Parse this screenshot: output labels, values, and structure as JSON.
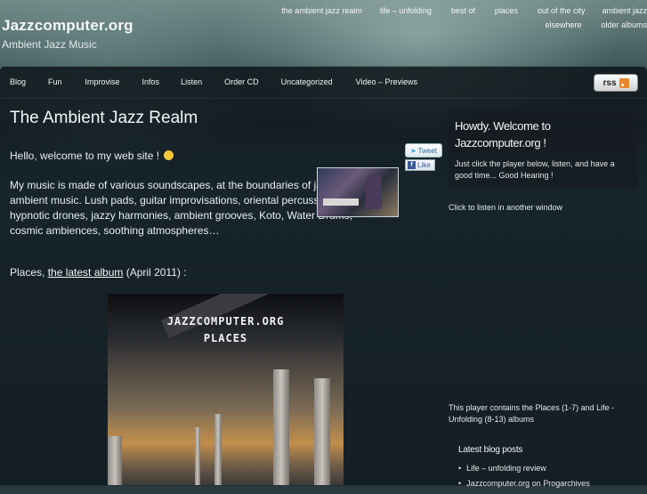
{
  "site": {
    "title": "Jazzcomputer.org",
    "tagline": "Ambient Jazz Music"
  },
  "topnav": {
    "row1": [
      "the ambient jazz realm",
      "life – unfolding",
      "best of",
      "places",
      "out of the city",
      "ambient jazz"
    ],
    "row2": [
      "elsewhere",
      "older albums"
    ]
  },
  "mainnav": [
    "Blog",
    "Fun",
    "Improvise",
    "Infos",
    "Listen",
    "Order CD",
    "Uncategorized",
    "Video – Previews"
  ],
  "rss": {
    "label": "rss"
  },
  "post": {
    "title": "The Ambient Jazz Realm",
    "greeting": "Hello, welcome to my web site !",
    "body": "My music is made of various soundscapes, at the boundaries of jazz, prog and ambient music. Lush pads, guitar improvisations, oriental percussions, hypnotic drones, jazzy harmonies, ambient grooves, Koto, Water Drums, cosmic ambiences, soothing atmospheres…",
    "places_prefix": "Places, ",
    "places_link": "the latest album",
    "places_suffix": " (April 2011) :",
    "cover_line1": "JAZZCOMPUTER.ORG",
    "cover_line2": "PLACES"
  },
  "social": {
    "tweet": "Tweet",
    "like": "Like",
    "fb": "f"
  },
  "sidebar": {
    "heading": "Howdy. Welcome to Jazzcomputer.org !",
    "intro": "Just click the player below, listen, and have a good time... Good Hearing !",
    "listen_link": "Click to listen in another window",
    "player_note": "This player contains the Places (1-7) and Life - Unfolding (8-13) albums",
    "latest_heading": "Latest blog posts",
    "latest_posts": [
      "Life – unfolding review",
      "Jazzcomputer.org on Progarchives"
    ]
  }
}
